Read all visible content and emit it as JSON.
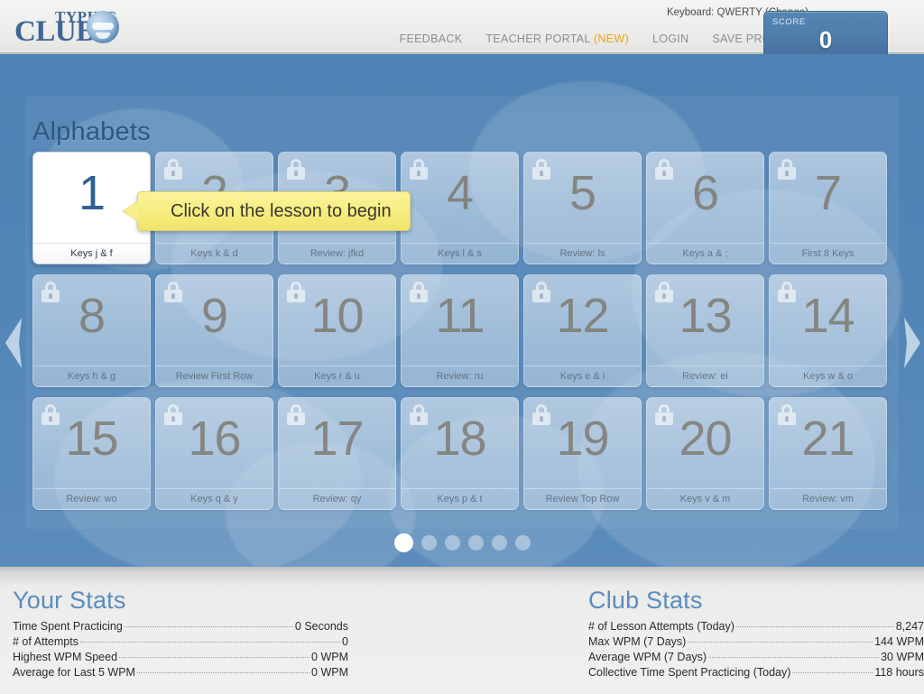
{
  "header": {
    "logo_top": "TYPING",
    "logo_bottom": "CLUB",
    "keyboard_prefix": "Keyboard: QWERTY (",
    "keyboard_label": "Keyboard: QWERTY",
    "keyboard_change": "Change",
    "keyboard_suffix": ")",
    "nav": [
      {
        "label": "FEEDBACK"
      },
      {
        "label": "TEACHER PORTAL "
      },
      {
        "label": "LOGIN"
      },
      {
        "label": "SAVE PROGRESS"
      }
    ],
    "teacher_portal_new": "(NEW)",
    "score_label": "SCORE",
    "score_value": "0"
  },
  "main": {
    "section_title": "Alphabets",
    "callout": "Click on the lesson to begin",
    "prev_arrow": "chevron-left",
    "next_arrow": "chevron-right",
    "dots_total": 6,
    "dots_active_index": 0,
    "lessons": [
      {
        "num": "1",
        "label": "Keys j & f",
        "locked": false
      },
      {
        "num": "2",
        "label": "Keys k & d",
        "locked": true
      },
      {
        "num": "3",
        "label": "Review: jfkd",
        "locked": true
      },
      {
        "num": "4",
        "label": "Keys l & s",
        "locked": true
      },
      {
        "num": "5",
        "label": "Review: ls",
        "locked": true
      },
      {
        "num": "6",
        "label": "Keys a & ;",
        "locked": true
      },
      {
        "num": "7",
        "label": "First 8 Keys",
        "locked": true
      },
      {
        "num": "8",
        "label": "Keys h & g",
        "locked": true
      },
      {
        "num": "9",
        "label": "Review First Row",
        "locked": true
      },
      {
        "num": "10",
        "label": "Keys r & u",
        "locked": true
      },
      {
        "num": "11",
        "label": "Review: ru",
        "locked": true
      },
      {
        "num": "12",
        "label": "Keys e & i",
        "locked": true
      },
      {
        "num": "13",
        "label": "Review: ei",
        "locked": true
      },
      {
        "num": "14",
        "label": "Keys w & o",
        "locked": true
      },
      {
        "num": "15",
        "label": "Review: wo",
        "locked": true
      },
      {
        "num": "16",
        "label": "Keys q & y",
        "locked": true
      },
      {
        "num": "17",
        "label": "Review: qy",
        "locked": true
      },
      {
        "num": "18",
        "label": "Keys p & t",
        "locked": true
      },
      {
        "num": "19",
        "label": "Review Top Row",
        "locked": true
      },
      {
        "num": "20",
        "label": "Keys v & m",
        "locked": true
      },
      {
        "num": "21",
        "label": "Review: vm",
        "locked": true
      }
    ]
  },
  "your_stats": {
    "title": "Your Stats",
    "rows": [
      {
        "name": "Time Spent Practicing",
        "value": "0 Seconds"
      },
      {
        "name": "# of Attempts",
        "value": "0"
      },
      {
        "name": "Highest WPM Speed",
        "value": "0 WPM"
      },
      {
        "name": "Average for Last 5 WPM",
        "value": "0 WPM"
      }
    ]
  },
  "club_stats": {
    "title": "Club Stats",
    "rows": [
      {
        "name": "# of Lesson Attempts (Today)",
        "value": "8,247"
      },
      {
        "name": "Max WPM (7 Days)",
        "value": "144 WPM"
      },
      {
        "name": "Average WPM (7 Days)",
        "value": "30 WPM"
      },
      {
        "name": "Collective Time Spent Practicing (Today)",
        "value": "118 hours"
      }
    ]
  },
  "colors": {
    "sky": "#5185b6",
    "accent_blue": "#2f6093",
    "callout_yellow": "#f6ee84",
    "nav_grey": "#8d8d8d",
    "new_orange": "#e8a317",
    "stats_title": "#5b8cc0"
  }
}
